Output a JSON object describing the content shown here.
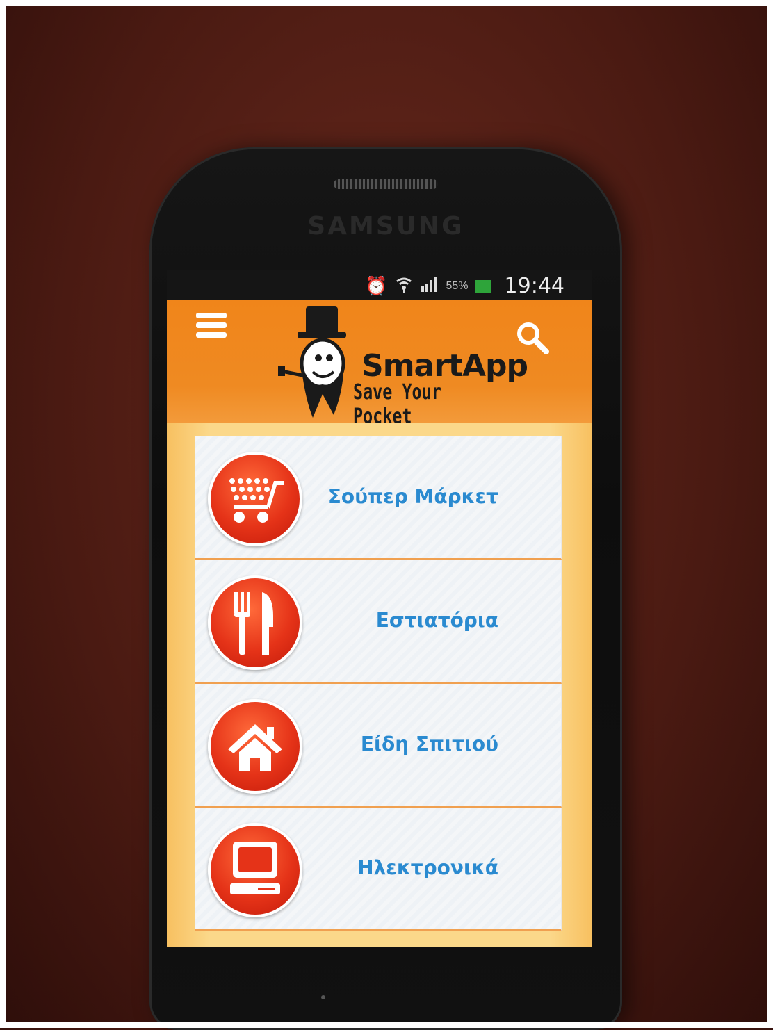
{
  "device": {
    "brand": "SAMSUNG",
    "status_bar": {
      "battery_percent": "55%",
      "time": "19:44",
      "icons": [
        "alarm-icon",
        "wifi-icon",
        "signal-icon",
        "battery-icon"
      ]
    }
  },
  "app": {
    "logo_title": "SmartApp",
    "logo_tagline": "Save Your Pocket",
    "header_color": "#f0851a"
  },
  "categories": [
    {
      "label": "Σούπερ Μάρκετ",
      "icon": "shopping-cart-icon"
    },
    {
      "label": "Εστιατόρια",
      "icon": "fork-knife-icon"
    },
    {
      "label": "Είδη Σπιτιού",
      "icon": "house-icon"
    },
    {
      "label": "Ηλεκτρονικά",
      "icon": "computer-icon"
    }
  ],
  "colors": {
    "category_text": "#2a8ad0",
    "icon_circle": "#e53318"
  }
}
